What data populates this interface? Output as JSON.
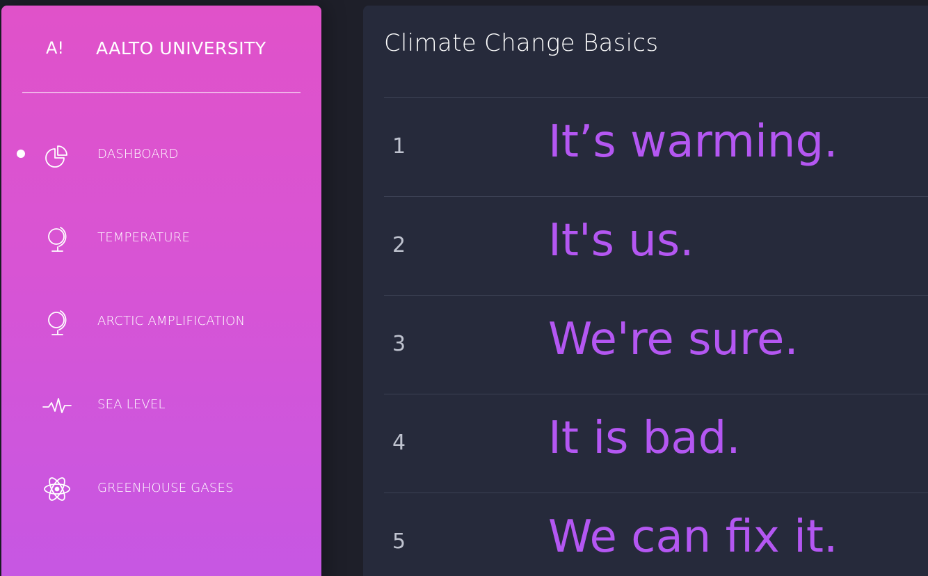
{
  "sidebar": {
    "logo": "A!",
    "brand_name": "AALTO UNIVERSITY",
    "items": [
      {
        "label": "DASHBOARD",
        "icon": "pie-chart-icon",
        "active": true
      },
      {
        "label": "TEMPERATURE",
        "icon": "globe-icon",
        "active": false
      },
      {
        "label": "ARCTIC AMPLIFICATION",
        "icon": "globe-icon",
        "active": false
      },
      {
        "label": "SEA LEVEL",
        "icon": "pulse-icon",
        "active": false
      },
      {
        "label": "GREENHOUSE GASES",
        "icon": "atom-icon",
        "active": false
      }
    ]
  },
  "main": {
    "title": "Climate Change Basics",
    "rows": [
      {
        "number": "1",
        "text": "It’s warming."
      },
      {
        "number": "2",
        "text": "It's us."
      },
      {
        "number": "3",
        "text": "We're sure."
      },
      {
        "number": "4",
        "text": "It is bad."
      },
      {
        "number": "5",
        "text": "We can fix it."
      }
    ]
  },
  "colors": {
    "sidebar_gradient_top": "#e052c9",
    "sidebar_gradient_bottom": "#c657e3",
    "panel_bg": "#262a3b",
    "page_bg": "#1e1f29",
    "accent_text": "#b457f2",
    "divider": "#3c4154"
  }
}
